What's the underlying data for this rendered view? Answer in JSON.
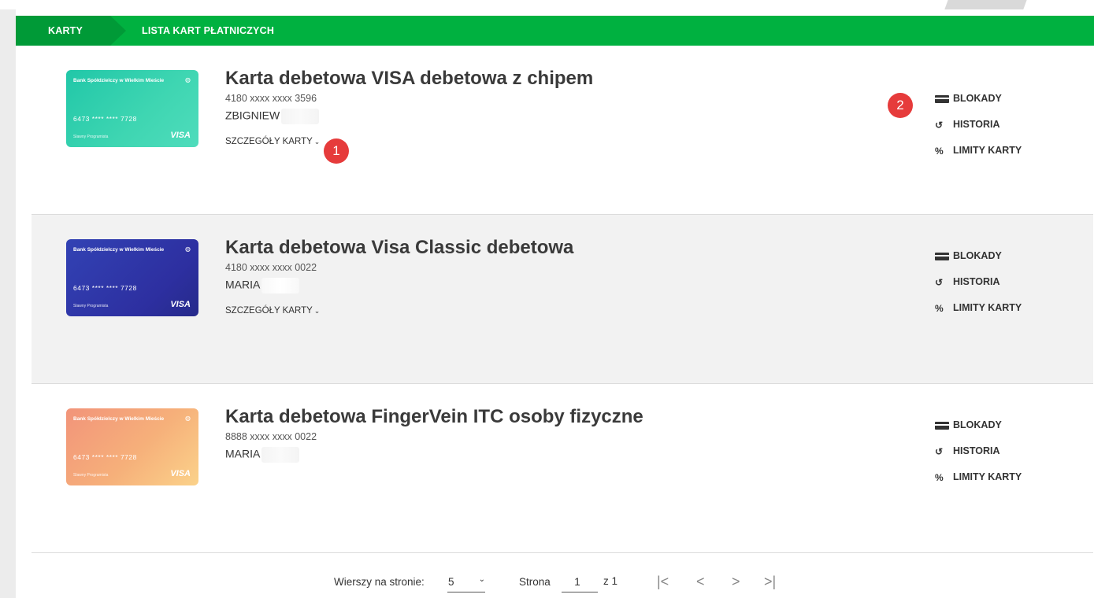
{
  "breadcrumb": {
    "items": [
      "KARTY",
      "LISTA KART PŁATNICZYCH"
    ]
  },
  "cards": [
    {
      "image": {
        "bank": "Bank Spółdzielczy w Wielkim Mieście",
        "number": "6473  ****  ****  7728",
        "holder": "Slawny Programista",
        "brand": "VISA",
        "color": "teal"
      },
      "title": "Karta debetowa VISA debetowa z chipem",
      "number": "4180 xxxx xxxx 3596",
      "owner": "ZBIGNIEW",
      "details": "SZCZEGÓŁY KARTY",
      "actions": [
        "BLOKADY",
        "HISTORIA",
        "LIMITY KARTY"
      ]
    },
    {
      "image": {
        "bank": "Bank Spółdzielczy w Wielkim Mieście",
        "number": "6473  ****  ****  7728",
        "holder": "Slawny Programista",
        "brand": "VISA",
        "color": "blue"
      },
      "title": "Karta debetowa Visa Classic debetowa",
      "number": "4180 xxxx xxxx 0022",
      "owner": "MARIA",
      "details": "SZCZEGÓŁY KARTY",
      "actions": [
        "BLOKADY",
        "HISTORIA",
        "LIMITY KARTY"
      ]
    },
    {
      "image": {
        "bank": "Bank Spółdzielczy w Wielkim Mieście",
        "number": "6473  ****  ****  7728",
        "holder": "Slawny Programista",
        "brand": "VISA",
        "color": "orange"
      },
      "title": "Karta debetowa FingerVein ITC osoby fizyczne",
      "number": "8888 xxxx xxxx 0022",
      "owner": "MARIA",
      "actions": [
        "BLOKADY",
        "HISTORIA",
        "LIMITY KARTY"
      ]
    }
  ],
  "annotations": [
    "1",
    "2"
  ],
  "pagination": {
    "rows_label": "Wierszy na stronie:",
    "rows_value": "5",
    "page_label": "Strona",
    "page_value": "1",
    "of_label": "z 1",
    "first": "|<",
    "prev": "<",
    "next": ">",
    "last": ">|"
  },
  "colors": {
    "accent": "#00b140",
    "accent_dark": "#009a37",
    "badge": "#e63b3b"
  }
}
